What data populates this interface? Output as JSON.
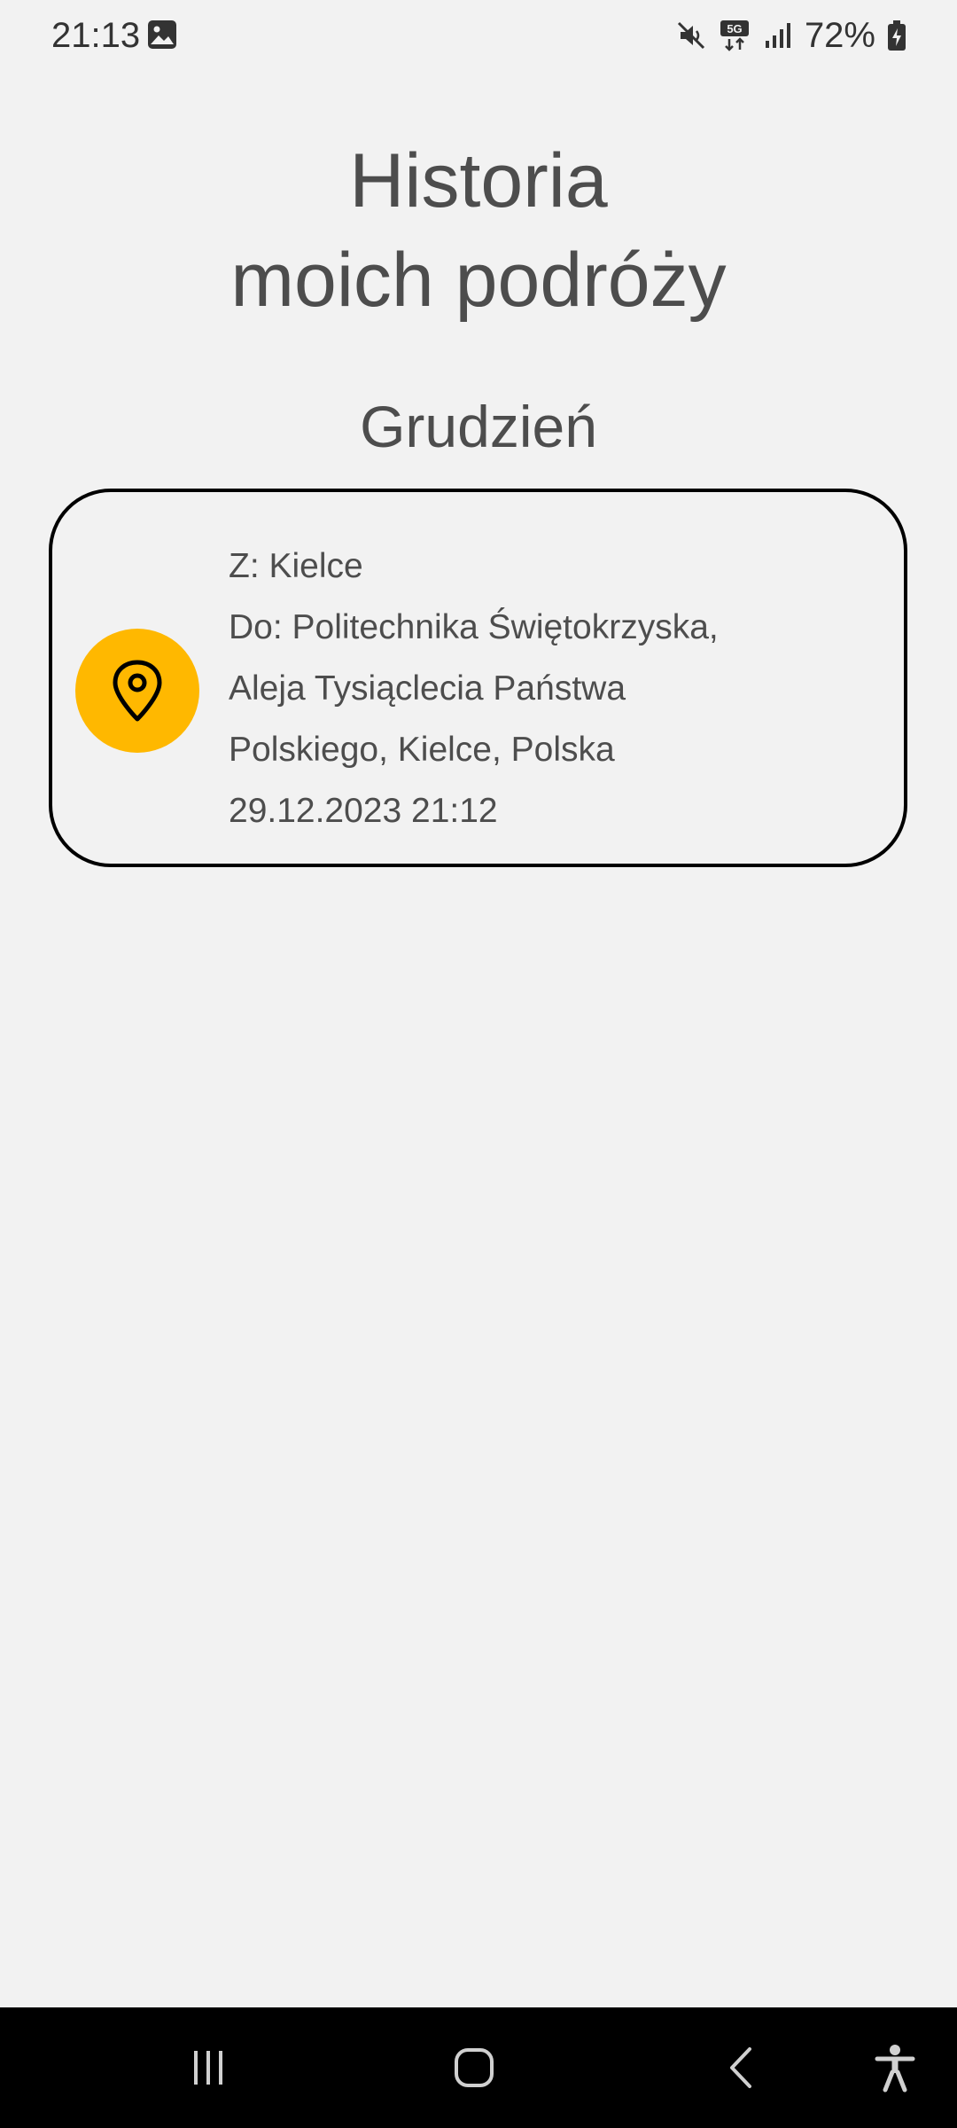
{
  "status_bar": {
    "time": "21:13",
    "left_icons": [
      "image-icon"
    ],
    "right_icons": [
      "mute-icon",
      "5g-icon",
      "signal-icon",
      "battery-icon"
    ],
    "battery_percent": "72%"
  },
  "header": {
    "title_line1": "Historia",
    "title_line2": "moich podróży"
  },
  "month_section": {
    "label": "Grudzień"
  },
  "trips": [
    {
      "icon": "location-pin-icon",
      "icon_bg": "#ffb800",
      "from_text": "Z: Kielce",
      "to_text": "Do: Politechnika Świętokrzyska, Aleja Tysiąclecia Państwa Polskiego, Kielce, Polska",
      "datetime": "29.12.2023 21:12"
    }
  ],
  "nav_bar": {
    "buttons": [
      "recent-apps-icon",
      "home-icon",
      "back-icon",
      "accessibility-icon"
    ]
  }
}
